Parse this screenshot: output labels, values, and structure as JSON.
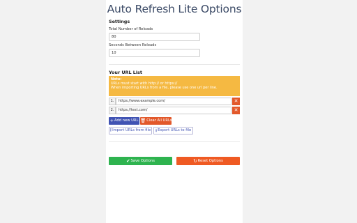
{
  "page": {
    "title": "Auto Refresh Lite Options"
  },
  "settings": {
    "heading": "Settings",
    "reloads_label": "Total Number of Reloads",
    "reloads_value": "80",
    "seconds_label": "Seconds Between Reloads",
    "seconds_value": "10"
  },
  "url_list": {
    "heading": "Your URL List",
    "note_title": "Note:",
    "note_line1": "URLs must start with http:// or https://",
    "note_line2": "When importing URLs from a file, please use one url per line.",
    "items": [
      {
        "num": "1.",
        "url": "https://www.example.com/"
      },
      {
        "num": "2.",
        "url": "https://test.com/"
      }
    ],
    "delete_icon": "close-icon"
  },
  "buttons": {
    "add_label": "Add new URL",
    "clear_label": "Clear All URLs",
    "import_label": "Import URLs from file",
    "export_label": "Export URLs to file",
    "save_label": "Save Options",
    "reset_label": "Reset Options"
  },
  "colors": {
    "accent": "#4053b3",
    "warning": "#f5b942",
    "danger": "#e2582a",
    "success": "#2eb34f"
  }
}
